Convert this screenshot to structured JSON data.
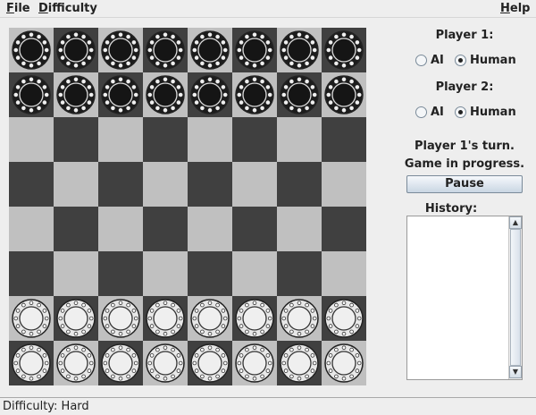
{
  "menubar": {
    "file": {
      "label_mnemonic": "F",
      "label_rest": "ile"
    },
    "difficulty": {
      "label_mnemonic": "D",
      "label_rest": "ifficulty"
    },
    "help": {
      "label_mnemonic": "H",
      "label_rest": "elp"
    }
  },
  "board": {
    "rows": 8,
    "cols": 8,
    "top_left_color": "light",
    "light_square_color": "#c0c0c0",
    "dark_square_color": "#404040",
    "pieces": [
      [
        "black",
        "black",
        "black",
        "black",
        "black",
        "black",
        "black",
        "black"
      ],
      [
        "black",
        "black",
        "black",
        "black",
        "black",
        "black",
        "black",
        "black"
      ],
      [
        "",
        "",
        "",
        "",
        "",
        "",
        "",
        ""
      ],
      [
        "",
        "",
        "",
        "",
        "",
        "",
        "",
        ""
      ],
      [
        "",
        "",
        "",
        "",
        "",
        "",
        "",
        ""
      ],
      [
        "",
        "",
        "",
        "",
        "",
        "",
        "",
        ""
      ],
      [
        "white",
        "white",
        "white",
        "white",
        "white",
        "white",
        "white",
        "white"
      ],
      [
        "white",
        "white",
        "white",
        "white",
        "white",
        "white",
        "white",
        "white"
      ]
    ],
    "black_piece_color": "#1c1c1c",
    "white_piece_color": "#e8e8e8"
  },
  "sidebar": {
    "player1": {
      "title": "Player 1:",
      "options": [
        {
          "label": "AI",
          "checked": false
        },
        {
          "label": "Human",
          "checked": true
        }
      ]
    },
    "player2": {
      "title": "Player 2:",
      "options": [
        {
          "label": "AI",
          "checked": false
        },
        {
          "label": "Human",
          "checked": true
        }
      ]
    },
    "turn_text": "Player 1's turn.",
    "game_status": "Game in progress.",
    "pause_label": "Pause",
    "history_label": "History:",
    "history_entries": []
  },
  "statusbar": {
    "text": "Difficulty: Hard"
  }
}
